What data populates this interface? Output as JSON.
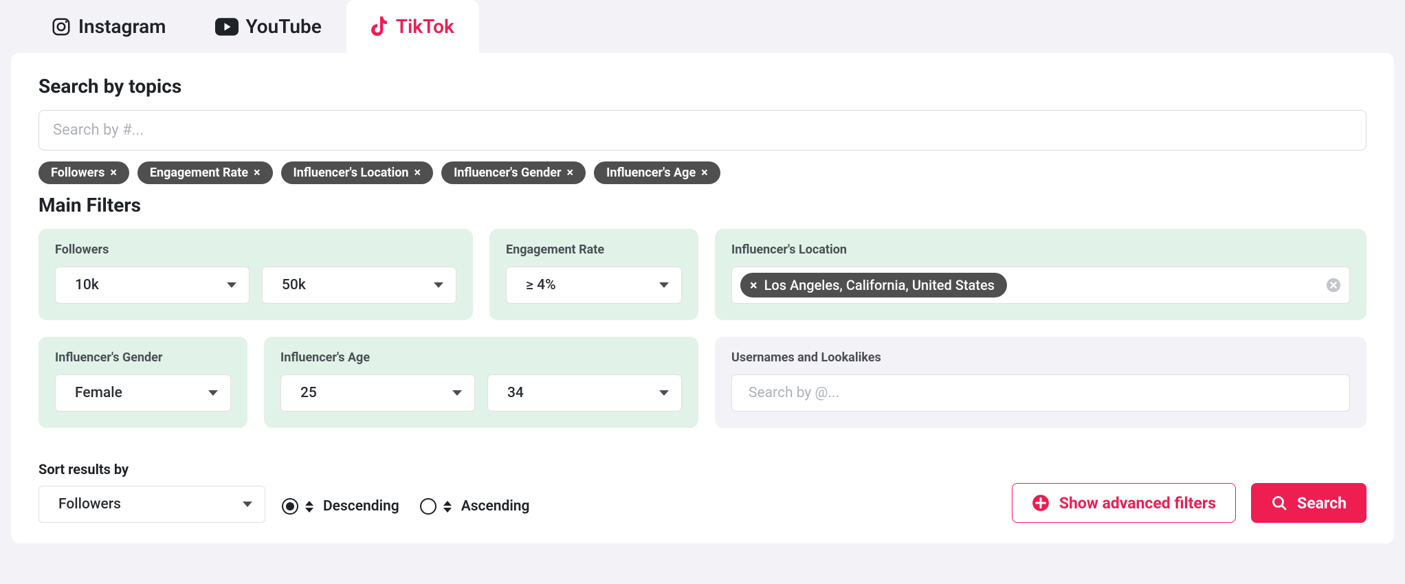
{
  "tabs": [
    {
      "label": "Instagram"
    },
    {
      "label": "YouTube"
    },
    {
      "label": "TikTok"
    }
  ],
  "search_by_topics": {
    "title": "Search by topics",
    "placeholder": "Search by #..."
  },
  "active_filter_chips": [
    "Followers",
    "Engagement Rate",
    "Influencer's Location",
    "Influencer's Gender",
    "Influencer's Age"
  ],
  "main_filters": {
    "title": "Main Filters",
    "followers": {
      "label": "Followers",
      "min": "10k",
      "max": "50k"
    },
    "engagement_rate": {
      "label": "Engagement Rate",
      "value": "≥ 4%"
    },
    "location": {
      "label": "Influencer's Location",
      "chip": "Los Angeles, California, United States"
    },
    "gender": {
      "label": "Influencer's Gender",
      "value": "Female"
    },
    "age": {
      "label": "Influencer's Age",
      "min": "25",
      "max": "34"
    },
    "usernames": {
      "label": "Usernames and Lookalikes",
      "placeholder": "Search by @..."
    }
  },
  "sort": {
    "label": "Sort results by",
    "by": "Followers",
    "descending": "Descending",
    "ascending": "Ascending"
  },
  "actions": {
    "advanced": "Show advanced filters",
    "search": "Search"
  }
}
